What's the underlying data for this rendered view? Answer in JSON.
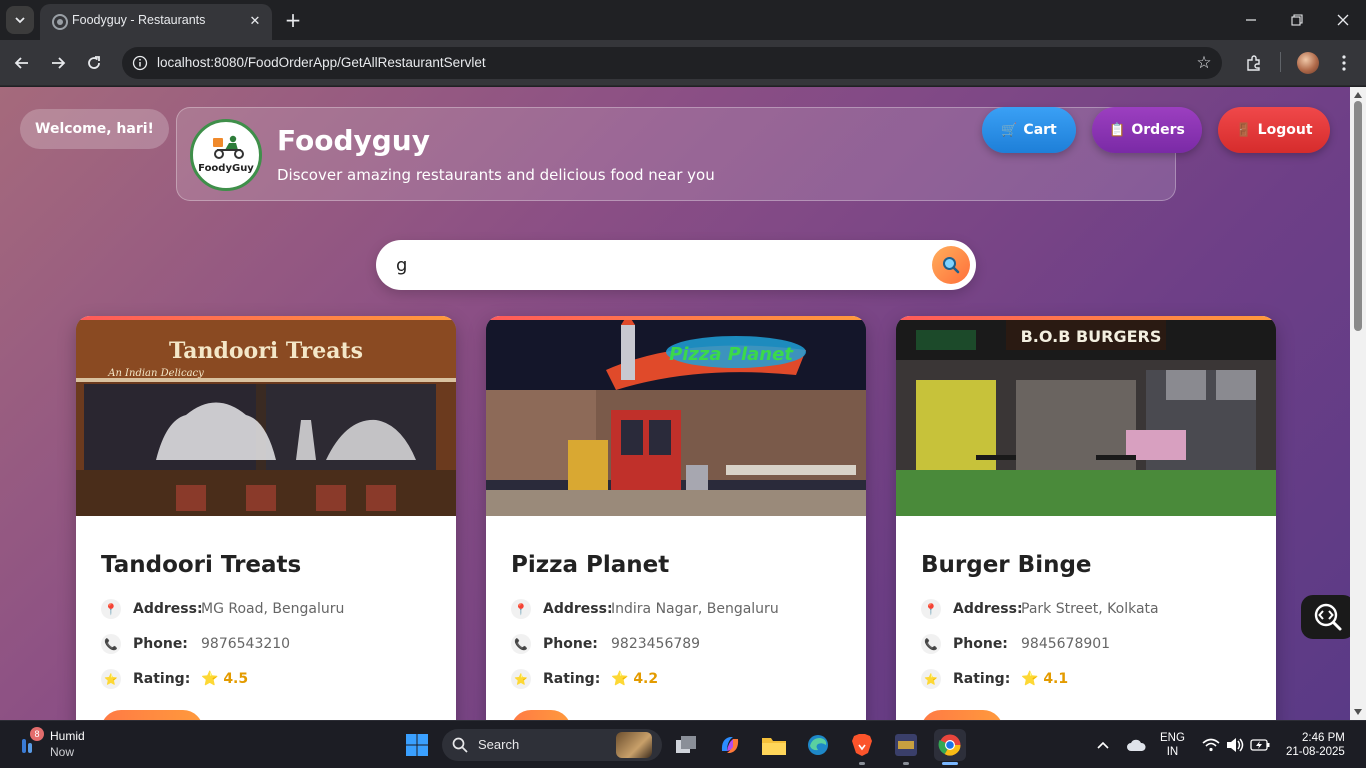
{
  "browser": {
    "tab_title": "Foodyguy - Restaurants",
    "url": "localhost:8080/FoodOrderApp/GetAllRestaurantServlet"
  },
  "page": {
    "welcome": "Welcome, hari!",
    "logo_text": "FoodyGuy",
    "brand": "Foodyguy",
    "tagline": "Discover amazing restaurants and delicious food near you",
    "nav": {
      "cart": "Cart",
      "orders": "Orders",
      "logout": "Logout"
    },
    "search": {
      "value": "g",
      "placeholder": ""
    },
    "labels": {
      "address": "Address:",
      "phone": "Phone:",
      "rating": "Rating:"
    },
    "restaurants": [
      {
        "name": "Tandoori Treats",
        "address": "MG Road, Bengaluru",
        "phone": "9876543210",
        "rating": "4.5",
        "sign": "Tandoori  Treats",
        "sign_sub": "An Indian Delicacy"
      },
      {
        "name": "Pizza Planet",
        "address": "Indira Nagar, Bengaluru",
        "phone": "9823456789",
        "rating": "4.2",
        "sign": "Pizza Planet"
      },
      {
        "name": "Burger Binge",
        "address": "Park Street, Kolkata",
        "phone": "9845678901",
        "rating": "4.1",
        "sign": "B.O.B BURGERS"
      }
    ]
  },
  "taskbar": {
    "weather_badge": "8",
    "weather_title": "Humid",
    "weather_sub": "Now",
    "search_label": "Search",
    "lang_top": "ENG",
    "lang_bottom": "IN",
    "time": "2:46 PM",
    "date": "21-08-2025"
  },
  "colors": {
    "cart": "#1e7fd8",
    "orders": "#7a2aa6",
    "logout": "#d62c2c",
    "rating": "#e39b00",
    "accent": "#ff7a45"
  },
  "icons": {
    "cart": "cart-icon",
    "orders": "receipt-icon",
    "logout": "door-icon",
    "address": "pin-icon",
    "phone": "phone-icon",
    "rating": "star-icon"
  }
}
